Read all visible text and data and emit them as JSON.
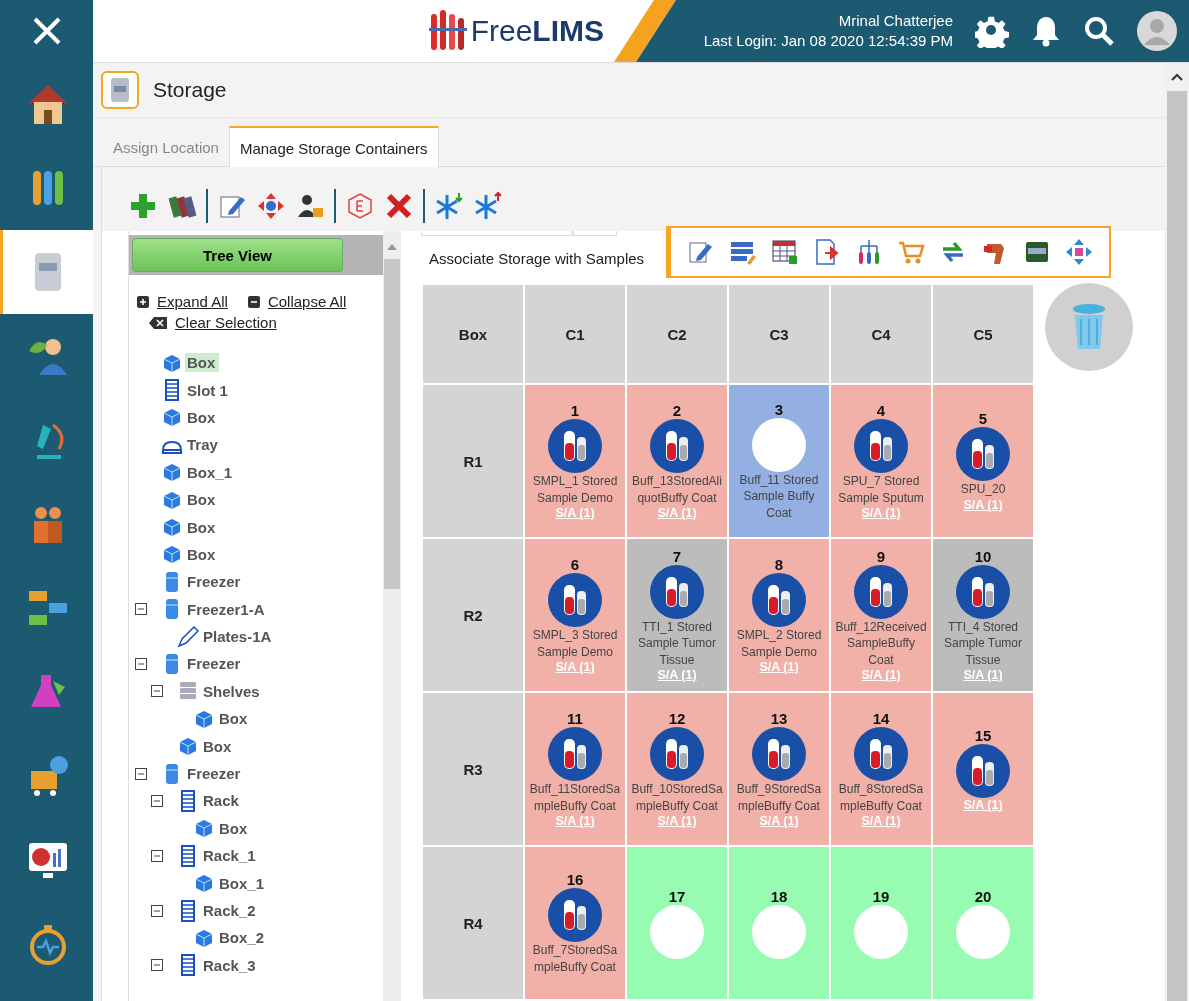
{
  "sidebar": {
    "items": [
      {
        "selected": false
      },
      {
        "selected": false
      },
      {
        "selected": true
      },
      {
        "selected": false
      },
      {
        "selected": false
      },
      {
        "selected": false
      },
      {
        "selected": false
      },
      {
        "selected": false
      },
      {
        "selected": false
      },
      {
        "selected": false
      },
      {
        "selected": false
      }
    ]
  },
  "header": {
    "logo": "Free**LIMS**",
    "user": "Mrinal Chatterjee",
    "last_login": "Last Login: Jan 08 2020 12:54:39 PM"
  },
  "page": {
    "title": "Storage"
  },
  "tabs": [
    {
      "label": "Assign Location",
      "selected": false
    },
    {
      "label": "Manage Storage Containers",
      "selected": true
    }
  ],
  "tree": {
    "button": "Tree View",
    "expand_all": "Expand All",
    "collapse_all": "Collapse All",
    "clear_selection": "Clear Selection",
    "items": [
      {
        "label": "Box",
        "kind": "box",
        "selected": true
      },
      {
        "label": "Slot 1",
        "kind": "rack",
        "selected": false
      },
      {
        "label": "Box",
        "kind": "box",
        "selected": false
      },
      {
        "label": "Tray",
        "kind": "tray",
        "selected": false
      },
      {
        "label": "Box_1",
        "kind": "box",
        "selected": false
      },
      {
        "label": "Box",
        "kind": "box",
        "selected": false
      },
      {
        "label": "Box",
        "kind": "box",
        "selected": false
      },
      {
        "label": "Box",
        "kind": "box",
        "selected": false
      },
      {
        "label": "Freezer",
        "kind": "freezer",
        "selected": false
      },
      {
        "label": "Freezer1-A",
        "kind": "freezer",
        "selected": false,
        "expanded": true,
        "children": [
          {
            "label": "Plates-1A",
            "kind": "plate",
            "selected": false
          }
        ]
      },
      {
        "label": "Freezer",
        "kind": "freezer",
        "selected": false,
        "expanded": true,
        "children": [
          {
            "label": "Shelves",
            "kind": "shelves",
            "selected": false,
            "expanded": true,
            "children": [
              {
                "label": "Box",
                "kind": "box",
                "selected": false
              }
            ]
          },
          {
            "label": "Box",
            "kind": "box",
            "selected": false
          }
        ]
      },
      {
        "label": "Freezer",
        "kind": "freezer",
        "selected": false,
        "expanded": true,
        "children": [
          {
            "label": "Rack",
            "kind": "rack",
            "selected": false,
            "expanded": true,
            "children": [
              {
                "label": "Box",
                "kind": "box",
                "selected": false
              }
            ]
          },
          {
            "label": "Rack_1",
            "kind": "rack",
            "selected": false,
            "expanded": true,
            "children": [
              {
                "label": "Box_1",
                "kind": "box",
                "selected": false
              }
            ]
          },
          {
            "label": "Rack_2",
            "kind": "rack",
            "selected": false,
            "expanded": true,
            "children": [
              {
                "label": "Box_2",
                "kind": "box",
                "selected": false
              }
            ]
          },
          {
            "label": "Rack_3",
            "kind": "rack",
            "selected": false,
            "expanded": true
          }
        ]
      }
    ]
  },
  "associate": {
    "label": "Associate Storage with Samples"
  },
  "grid": {
    "corner": "Box",
    "columns": [
      "C1",
      "C2",
      "C3",
      "C4",
      "C5"
    ],
    "rows": [
      {
        "label": "R1",
        "cells": [
          {
            "number": "1",
            "kind": "sample",
            "color": "#f2b1a8",
            "label": "SMPL_1 Stored Sample Demo",
            "link": "S/A (1)"
          },
          {
            "number": "2",
            "kind": "sample",
            "color": "#f2b1a8",
            "label": "Buff_13StoredAliquotBuffy Coat",
            "link": "S/A (1)"
          },
          {
            "number": "3",
            "kind": "empty",
            "color": "#94afe2",
            "label": "Buff_11 Stored Sample Buffy Coat"
          },
          {
            "number": "4",
            "kind": "sample",
            "color": "#f2b1a8",
            "label": "SPU_7 Stored Sample Sputum",
            "link": "S/A (1)"
          },
          {
            "number": "5",
            "kind": "sample",
            "color": "#f2b1a8",
            "label": "SPU_20",
            "link": "S/A (1)"
          }
        ]
      },
      {
        "label": "R2",
        "cells": [
          {
            "number": "6",
            "kind": "sample",
            "color": "#f2b1a8",
            "label": "SMPL_3 Stored Sample Demo",
            "link": "S/A (1)"
          },
          {
            "number": "7",
            "kind": "sample",
            "color": "#bcbcbc",
            "label": "TTI_1 Stored Sample Tumor Tissue",
            "link": "S/A (1)"
          },
          {
            "number": "8",
            "kind": "sample",
            "color": "#f2b1a8",
            "label": "SMPL_2 Stored Sample Demo",
            "link": "S/A (1)"
          },
          {
            "number": "9",
            "kind": "sample",
            "color": "#f2b1a8",
            "label": "Buff_12ReceivedSampleBuffy Coat",
            "link": "S/A (1)"
          },
          {
            "number": "10",
            "kind": "sample",
            "color": "#bcbcbc",
            "label": "TTI_4 Stored Sample Tumor Tissue",
            "link": "S/A (1)"
          }
        ]
      },
      {
        "label": "R3",
        "cells": [
          {
            "number": "11",
            "kind": "sample",
            "color": "#f2b1a8",
            "label": "Buff_11StoredSampleBuffy Coat",
            "link": "S/A (1)"
          },
          {
            "number": "12",
            "kind": "sample",
            "color": "#f2b1a8",
            "label": "Buff_10StoredSampleBuffy Coat",
            "link": "S/A (1)"
          },
          {
            "number": "13",
            "kind": "sample",
            "color": "#f2b1a8",
            "label": "Buff_9StoredSampleBuffy Coat",
            "link": "S/A (1)"
          },
          {
            "number": "14",
            "kind": "sample",
            "color": "#f2b1a8",
            "label": "Buff_8StoredSampleBuffy Coat",
            "link": "S/A (1)"
          },
          {
            "number": "15",
            "kind": "sample",
            "color": "#f2b1a8",
            "link": "S/A (1)"
          }
        ]
      },
      {
        "label": "R4",
        "cells": [
          {
            "number": "16",
            "kind": "sample",
            "color": "#f2b1a8",
            "label": "Buff_7StoredSampleBuffy Coat"
          },
          {
            "number": "17",
            "kind": "empty",
            "color": "#98fbb2"
          },
          {
            "number": "18",
            "kind": "empty",
            "color": "#98fbb2"
          },
          {
            "number": "19",
            "kind": "empty",
            "color": "#98fbb2"
          },
          {
            "number": "20",
            "kind": "empty",
            "color": "#98fbb2"
          }
        ]
      }
    ]
  }
}
